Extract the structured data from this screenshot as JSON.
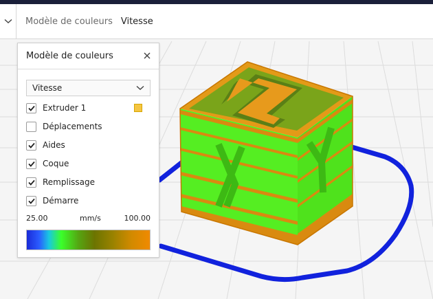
{
  "header": {
    "title": "Modèle de couleurs",
    "value": "Vitesse"
  },
  "panel": {
    "title": "Modèle de couleurs",
    "scheme_select": {
      "selected": "Vitesse"
    },
    "options": [
      {
        "label": "Extruder 1",
        "checked": true,
        "swatch_color": "#f5c542"
      },
      {
        "label": "Déplacements",
        "checked": false
      },
      {
        "label": "Aides",
        "checked": true
      },
      {
        "label": "Coque",
        "checked": true
      },
      {
        "label": "Remplissage",
        "checked": true
      },
      {
        "label": "Démarre",
        "checked": true
      }
    ],
    "legend": {
      "min": "25.00",
      "unit": "mm/s",
      "max": "100.00"
    }
  },
  "colors": {
    "travel_lines": "#1122dd",
    "infill_green": "#55ee22",
    "shell_orange": "#e88a00"
  }
}
